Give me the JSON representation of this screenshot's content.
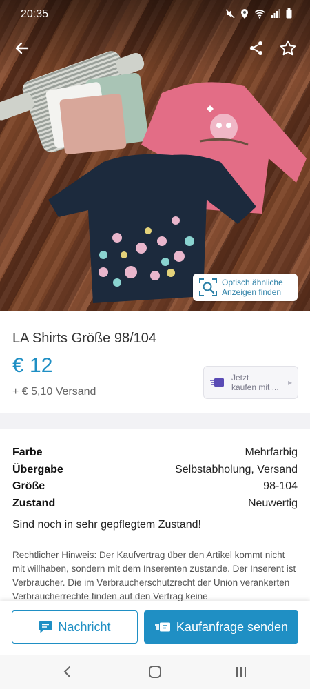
{
  "status_bar": {
    "time": "20:35",
    "icons": [
      "mute-icon",
      "location-icon",
      "wifi-icon",
      "signal-icon",
      "battery-icon"
    ]
  },
  "toolbar": {
    "icons": [
      "back-arrow-icon",
      "share-icon",
      "star-outline-icon"
    ]
  },
  "visual_search": {
    "line1": "Optisch ähnliche",
    "line2": "Anzeigen finden",
    "icon": "visual-search-icon"
  },
  "listing": {
    "title": "LA Shirts Größe 98/104",
    "price": "€ 12",
    "shipping": "+ € 5,10 Versand",
    "buy_now": {
      "line1": "Jetzt",
      "line2": "kaufen mit ...",
      "icon": "fast-delivery-icon"
    }
  },
  "attributes": [
    {
      "key": "Farbe",
      "value": "Mehrfarbig"
    },
    {
      "key": "Übergabe",
      "value": "Selbstabholung, Versand"
    },
    {
      "key": "Größe",
      "value": "98-104"
    },
    {
      "key": "Zustand",
      "value": "Neuwertig"
    }
  ],
  "description": "Sind noch in sehr gepflegtem Zustand!",
  "legal_notice": "Rechtlicher Hinweis: Der Kaufvertrag über den Artikel kommt nicht mit willhaben, sondern mit dem Inserenten zustande. Der Inserent ist Verbraucher. Die im Verbraucherschutzrecht der Union verankerten Verbraucherrechte finden auf den Vertrag keine",
  "actions": {
    "message_label": "Nachricht",
    "buy_request_label": "Kaufanfrage senden"
  },
  "navigation": {
    "icons": [
      "back-nav-icon",
      "home-nav-icon",
      "recent-apps-icon"
    ]
  },
  "colors": {
    "accent": "#1f8fc4",
    "nav_background": "#f7f7f7"
  }
}
